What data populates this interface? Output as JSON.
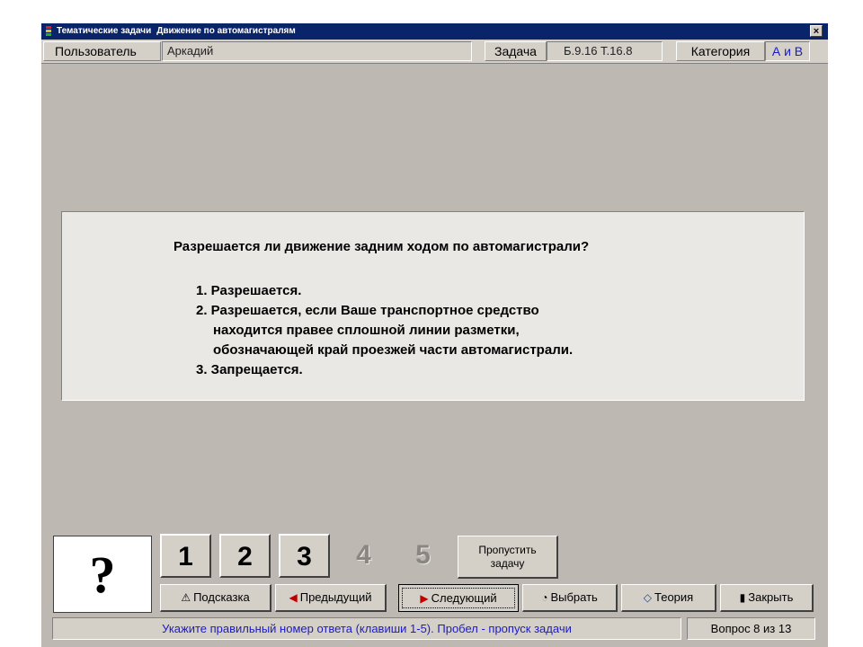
{
  "window": {
    "title": "Тематические задачи",
    "subtitle": "Движение по автомагистралям",
    "close_glyph": "×"
  },
  "info": {
    "user_label": "Пользователь",
    "user_value": "Аркадий",
    "task_label": "Задача",
    "task_value": "Б.9.16 Т.16.8",
    "category_label": "Категория",
    "category_value": "А и В"
  },
  "question": {
    "text": "Разрешается ли движение задним ходом по автомагистрали?",
    "answers": {
      "a1": "1. Разрешается.",
      "a2_line1": "2. Разрешается, если Ваше транспортное средство",
      "a2_line2": "находится правее сплошной линии разметки,",
      "a2_line3": "обозначающей край проезжей части автомагистрали.",
      "a3": "3. Запрещается."
    }
  },
  "answer_indicator": "?",
  "number_buttons": [
    "1",
    "2",
    "3",
    "4",
    "5"
  ],
  "skip_button": {
    "line1": "Пропустить",
    "line2": "задачу"
  },
  "actions": {
    "hint": "Подсказка",
    "prev": "Предыдущий",
    "next": "Следующий",
    "choose": "Выбрать",
    "theory": "Теория",
    "close": "Закрыть"
  },
  "status": {
    "hint_text": "Укажите правильный номер ответа (клавиши 1-5). Пробел - пропуск задачи",
    "counter": "Вопрос 8 из 13"
  },
  "colors": {
    "titlebar": "#0a246a",
    "background": "#bdb8b2",
    "status_text": "#1a1acc",
    "category_value": "#1a1acc"
  }
}
